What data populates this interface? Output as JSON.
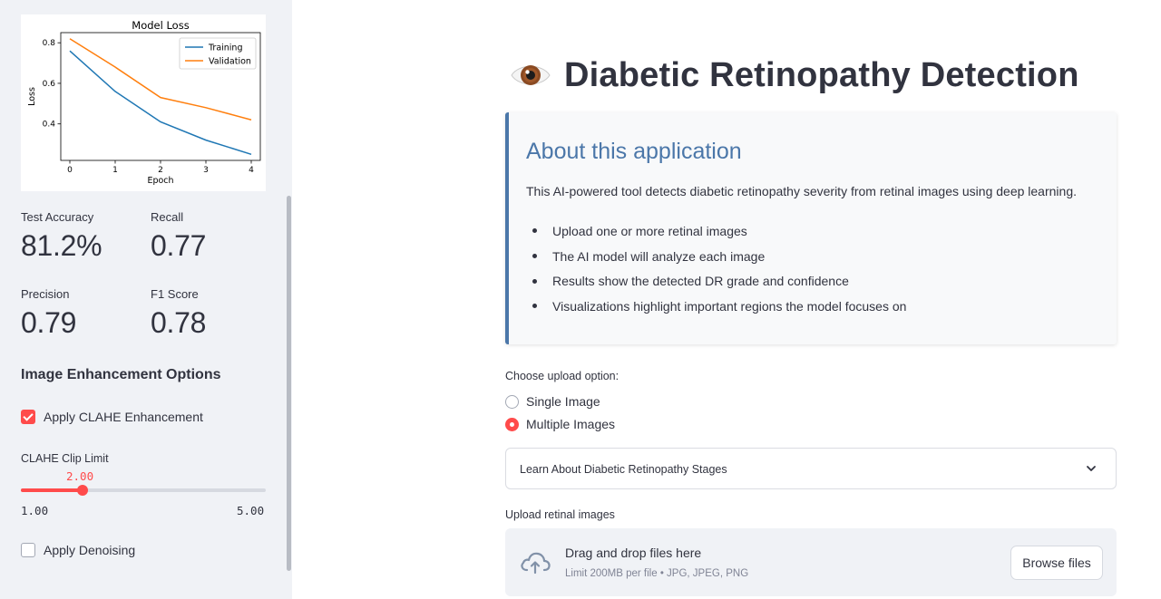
{
  "sidebar": {
    "chart": {
      "title": "Model Loss",
      "xlabel": "Epoch",
      "ylabel": "Loss",
      "legend": [
        "Training",
        "Validation"
      ]
    },
    "metrics": [
      {
        "label": "Test Accuracy",
        "value": "81.2%"
      },
      {
        "label": "Recall",
        "value": "0.77"
      },
      {
        "label": "Precision",
        "value": "0.79"
      },
      {
        "label": "F1 Score",
        "value": "0.78"
      }
    ],
    "enhancement_heading": "Image Enhancement Options",
    "clahe_checkbox": {
      "label": "Apply CLAHE Enhancement",
      "checked": true
    },
    "clip_slider": {
      "label": "CLAHE Clip Limit",
      "value": "2.00",
      "min": "1.00",
      "max": "5.00",
      "fraction": 0.25
    },
    "denoise_checkbox": {
      "label": "Apply Denoising",
      "checked": false
    }
  },
  "chart_data": {
    "type": "line",
    "title": "Model Loss",
    "xlabel": "Epoch",
    "ylabel": "Loss",
    "x": [
      0,
      1,
      2,
      3,
      4
    ],
    "series": [
      {
        "name": "Training",
        "values": [
          0.76,
          0.56,
          0.41,
          0.32,
          0.25
        ],
        "color": "#1f77b4"
      },
      {
        "name": "Validation",
        "values": [
          0.82,
          0.68,
          0.53,
          0.48,
          0.42
        ],
        "color": "#ff7f0e"
      }
    ],
    "xlim": [
      -0.2,
      4.2
    ],
    "ylim": [
      0.22,
      0.85
    ],
    "xticks": [
      "0",
      "1",
      "2",
      "3",
      "4"
    ],
    "yticks": [
      "0.4",
      "0.6",
      "0.8"
    ],
    "legend_position": "top-right",
    "grid": false
  },
  "main": {
    "title": "Diabetic Retinopathy Detection",
    "title_icon": "eye-icon",
    "about": {
      "heading": "About this application",
      "description": "This AI-powered tool detects diabetic retinopathy severity from retinal images using deep learning.",
      "bullets": [
        "Upload one or more retinal images",
        "The AI model will analyze each image",
        "Results show the detected DR grade and confidence",
        "Visualizations highlight important regions the model focuses on"
      ]
    },
    "upload_option": {
      "label": "Choose upload option:",
      "options": [
        "Single Image",
        "Multiple Images"
      ],
      "selected": "Multiple Images"
    },
    "expander_label": "Learn About Diabetic Retinopathy Stages",
    "uploader": {
      "label": "Upload retinal images",
      "title": "Drag and drop files here",
      "subtitle": "Limit 200MB per file • JPG, JPEG, PNG",
      "button": "Browse files"
    }
  },
  "colors": {
    "accent": "#ff4b4b",
    "heading_blue": "#4b77a9",
    "sidebar_bg": "#f0f2f6"
  }
}
